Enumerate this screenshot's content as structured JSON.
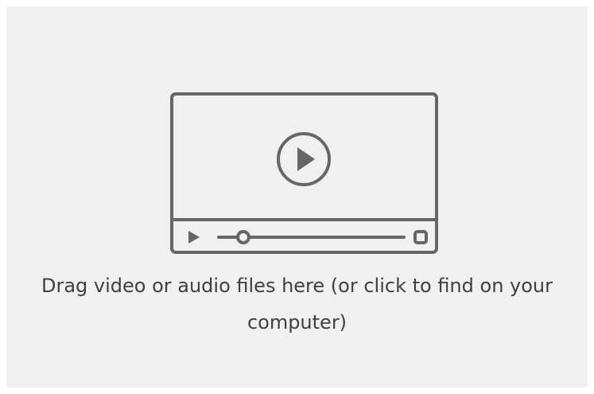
{
  "dropzone": {
    "message": "Drag video or audio files here (or click to find on your computer)",
    "icon": "video-player-icon"
  },
  "colors": {
    "background": "#f0f0f0",
    "icon_stroke": "#666666",
    "text": "#404040"
  }
}
